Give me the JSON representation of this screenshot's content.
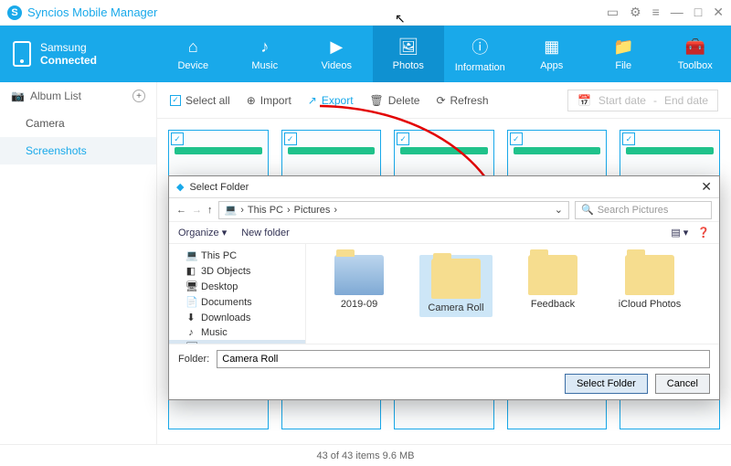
{
  "app": {
    "title": "Syncios Mobile Manager"
  },
  "device": {
    "brand": "Samsung",
    "status": "Connected"
  },
  "nav": {
    "items": [
      {
        "label": "Device",
        "icon": "⌂"
      },
      {
        "label": "Music",
        "icon": "♪"
      },
      {
        "label": "Videos",
        "icon": "▶"
      },
      {
        "label": "Photos",
        "icon": "🖼"
      },
      {
        "label": "Information",
        "icon": "ⓘ"
      },
      {
        "label": "Apps",
        "icon": "▦"
      },
      {
        "label": "File",
        "icon": "📁"
      },
      {
        "label": "Toolbox",
        "icon": "🧰"
      }
    ],
    "active": 3
  },
  "sidebar": {
    "heading": "Album List",
    "items": [
      {
        "label": "Camera"
      },
      {
        "label": "Screenshots"
      }
    ],
    "active": 1
  },
  "toolbar": {
    "select_all": "Select all",
    "import": "Import",
    "export": "Export",
    "delete": "Delete",
    "refresh": "Refresh",
    "start_date": "Start date",
    "end_date": "End date"
  },
  "status": {
    "text": "43 of 43 items 9.6 MB"
  },
  "dialog": {
    "title": "Select Folder",
    "breadcrumb": [
      "This PC",
      "Pictures"
    ],
    "search_placeholder": "Search Pictures",
    "organize": "Organize",
    "new_folder": "New folder",
    "tree": [
      {
        "label": "This PC",
        "icon": "💻"
      },
      {
        "label": "3D Objects",
        "icon": "◧"
      },
      {
        "label": "Desktop",
        "icon": "🖥"
      },
      {
        "label": "Documents",
        "icon": "📄"
      },
      {
        "label": "Downloads",
        "icon": "⬇"
      },
      {
        "label": "Music",
        "icon": "♪"
      },
      {
        "label": "Pictures",
        "icon": "🖼"
      }
    ],
    "tree_selected": 6,
    "folders": [
      {
        "label": "2019-09",
        "kind": "img"
      },
      {
        "label": "Camera Roll",
        "kind": "folder",
        "selected": true
      },
      {
        "label": "Feedback",
        "kind": "folder"
      },
      {
        "label": "iCloud Photos",
        "kind": "folder"
      }
    ],
    "folder_label": "Folder:",
    "folder_value": "Camera Roll",
    "select_btn": "Select Folder",
    "cancel_btn": "Cancel"
  }
}
